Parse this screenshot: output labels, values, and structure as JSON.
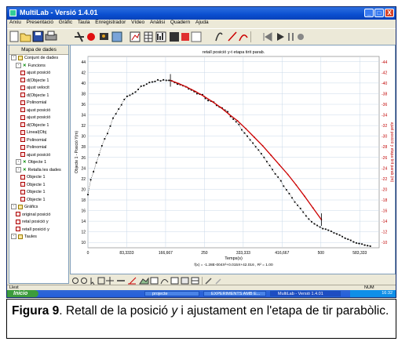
{
  "app": {
    "title": "MultiLab - Versió 1.4.01",
    "window_buttons": {
      "minimize": "_",
      "maximize": "□",
      "close": "X"
    }
  },
  "menu": [
    "Arxiu",
    "Presentació",
    "Gràfic",
    "Taula",
    "Enregistrador",
    "Vídeo",
    "Anàlisi",
    "Quadern",
    "Ajuda"
  ],
  "toolbar": {
    "icons": [
      "new-file-icon",
      "open-folder-icon",
      "save-icon",
      "print-icon",
      "connect-icon",
      "record-icon",
      "video-icon",
      "calculator-icon",
      "graph-icon",
      "table-icon",
      "bar-meter-icon",
      "hand-icon",
      "function-icon",
      "fit-icon",
      "curve-icon",
      "rewind-icon",
      "play-icon",
      "pause-icon",
      "stop-icon"
    ]
  },
  "left_panel": {
    "header": "Mapa de dades",
    "tree": [
      {
        "label": "Conjunt de dades",
        "type": "folder",
        "indent": 0
      },
      {
        "label": "Funcions",
        "type": "x",
        "indent": 1
      },
      {
        "label": "ajust posició",
        "type": "fn",
        "indent": 2
      },
      {
        "label": "d(Objecte 1",
        "type": "fn",
        "indent": 2
      },
      {
        "label": "ajust velocit",
        "type": "fn",
        "indent": 2
      },
      {
        "label": "d(Objecte 1",
        "type": "fn",
        "indent": 2
      },
      {
        "label": "Polinomial",
        "type": "fn",
        "indent": 2
      },
      {
        "label": "ajust posició",
        "type": "fn",
        "indent": 2
      },
      {
        "label": "ajust posició",
        "type": "fn",
        "indent": 2
      },
      {
        "label": "d(Objecte 1",
        "type": "fn",
        "indent": 2
      },
      {
        "label": "Lineal(Obj",
        "type": "fn",
        "indent": 2
      },
      {
        "label": "Polinomial",
        "type": "fn",
        "indent": 2
      },
      {
        "label": "Polinomial",
        "type": "fn",
        "indent": 2
      },
      {
        "label": "ajust posició",
        "type": "fn",
        "indent": 2
      },
      {
        "label": "Objecte 1",
        "type": "x",
        "indent": 1
      },
      {
        "label": "Retalla les dades",
        "type": "x",
        "indent": 1
      },
      {
        "label": "Objecte 1",
        "type": "fn",
        "indent": 2
      },
      {
        "label": "Objecte 1",
        "type": "fn",
        "indent": 2
      },
      {
        "label": "Objecte 1",
        "type": "fn",
        "indent": 2
      },
      {
        "label": "Objecte 1",
        "type": "fn",
        "indent": 2
      },
      {
        "label": "Gràfics",
        "type": "folder",
        "indent": 0
      },
      {
        "label": "original posició",
        "type": "fn",
        "indent": 1
      },
      {
        "label": "retal posició y",
        "type": "fn",
        "indent": 1
      },
      {
        "label": "retall posició y",
        "type": "fn",
        "indent": 1
      },
      {
        "label": "Taules",
        "type": "folder",
        "indent": 0
      }
    ]
  },
  "chart_data": {
    "type": "scatter",
    "title": "retall posició y-t etapa tirit parab.",
    "xlabel": "Temps(s)",
    "ylabel_left": "Objecte 1 - Posició Y(m)",
    "ylabel_right": "ajust posició y etapa tirit parab.(m)",
    "x_ticks": [
      "0",
      "83,3333",
      "166,667",
      "250",
      "333,333",
      "416,667",
      "500",
      "583,333"
    ],
    "x_tick_values": [
      0,
      83.3333,
      166.667,
      250,
      333.333,
      416.667,
      500,
      583.333
    ],
    "y_ticks_left": [
      "10",
      "12",
      "14",
      "16",
      "18",
      "20",
      "22",
      "24",
      "26",
      "28",
      "30",
      "32",
      "34",
      "36",
      "38",
      "40",
      "42",
      "44"
    ],
    "y_ticks_right": [
      "10",
      "12",
      "14",
      "16",
      "18",
      "20",
      "22",
      "24",
      "26",
      "28",
      "30",
      "32",
      "34",
      "36",
      "38",
      "40",
      "42",
      "44"
    ],
    "xlim": [
      0,
      625
    ],
    "ylim": [
      9,
      45
    ],
    "series": [
      {
        "kind": "data",
        "color": "#000000",
        "x": [
          0,
          6,
          12,
          18,
          24,
          30,
          36,
          42,
          48,
          54,
          60,
          66,
          72,
          78,
          84,
          90,
          96,
          102,
          108,
          114,
          120,
          126,
          132,
          138,
          144,
          150,
          156,
          162,
          168,
          174,
          180,
          186,
          192,
          198,
          204,
          210,
          216,
          222,
          228,
          234,
          240,
          246,
          252,
          258,
          264,
          270,
          276,
          282,
          288,
          294,
          300,
          306,
          312,
          318,
          324,
          330,
          336,
          342,
          348,
          354,
          360,
          366,
          372,
          378,
          384,
          390,
          396,
          402,
          408,
          414,
          420,
          426,
          432,
          438,
          444,
          450,
          456,
          462,
          468,
          474,
          480,
          486,
          492,
          498,
          504,
          510,
          516,
          522,
          528,
          534,
          540,
          546,
          552,
          558,
          564,
          570,
          576,
          582,
          588,
          594,
          600,
          606
        ],
        "y": [
          19,
          21.8,
          23.3,
          25,
          26.5,
          28.2,
          29.5,
          30.5,
          31.9,
          33.4,
          34.2,
          35.1,
          35.9,
          36.9,
          37.5,
          37.7,
          38,
          38.3,
          38.8,
          39.4,
          39.5,
          39.8,
          40.1,
          40.2,
          40.3,
          40.6,
          40.4,
          40.6,
          40.5,
          40.5,
          40.4,
          40.1,
          39.8,
          39.7,
          39.5,
          39.3,
          38.9,
          38.7,
          38.4,
          38,
          37.9,
          37.8,
          37.1,
          36.7,
          36.6,
          36.4,
          35.8,
          35.5,
          35.3,
          34.9,
          34.6,
          33.7,
          33.2,
          32.7,
          32.2,
          31.2,
          30.6,
          30,
          29.3,
          28.7,
          28,
          27.4,
          26.7,
          26,
          25.2,
          24.5,
          23.7,
          22.9,
          22.3,
          21.6,
          20.6,
          19.9,
          19.2,
          18.4,
          17.6,
          17,
          16.4,
          15.7,
          15,
          14.4,
          13.9,
          13.5,
          13.2,
          12.9,
          12.6,
          12.5,
          12.3,
          12.1,
          11.8,
          11.6,
          11.4,
          11.1,
          10.8,
          10.6,
          10.4,
          10.1,
          9.9,
          9.8,
          9.7,
          9.5,
          9.4,
          9.3
        ]
      },
      {
        "kind": "fit",
        "color": "#cc0000",
        "x": [
          177,
          195,
          213,
          231,
          249,
          267,
          285,
          303,
          321,
          339,
          357,
          375,
          393,
          411,
          429,
          447,
          465,
          483,
          501
        ],
        "y": [
          40.5,
          39.9,
          39.2,
          38.4,
          37.5,
          36.5,
          35.4,
          34.1,
          32.9,
          31.4,
          29.8,
          28.2,
          26.4,
          24.6,
          22.8,
          20.8,
          18.7,
          16.5,
          14.3
        ]
      }
    ],
    "cursors": [
      {
        "x": 177,
        "y": 40.5
      },
      {
        "x": 501,
        "y": 14.3
      }
    ],
    "fit_equation": "f(x) = -1.28E-004X²+0.015X+42.016 ,  R² = 1.00"
  },
  "bottom_toolbar": {
    "icons": [
      "zoom-in-icon",
      "zoom-out-icon",
      "cursor-icon",
      "marker-icon",
      "crosshair-icon",
      "slope-icon",
      "area-icon",
      "statistics-icon",
      "smooth-icon",
      "derivative-icon",
      "fit-icon",
      "table-icon",
      "export-icon",
      "edit-icon",
      "clear-icon"
    ]
  },
  "status": {
    "left": "Llest",
    "right": "NUM"
  },
  "taskbar": {
    "start_label": "Inicio",
    "tasks": [
      "projecte",
      "EXPERIMENTS AMB E...",
      "MultiLab - Versió 1.4.01"
    ],
    "time": "16:32"
  },
  "caption": {
    "label": "Figura 9",
    "text_before": ". Retall de la posició ",
    "italic": "y",
    "text_after": " i ajustament en l'etapa de tir parabòlic."
  }
}
